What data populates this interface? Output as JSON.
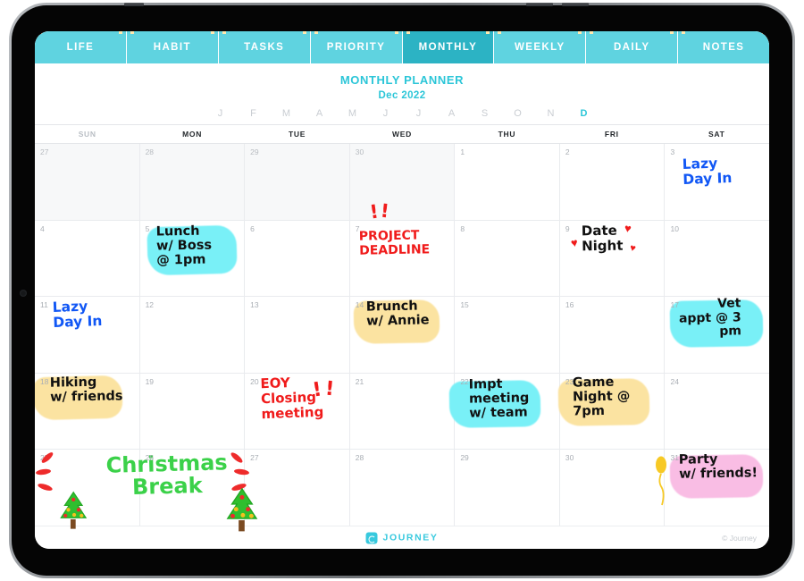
{
  "tabs": [
    {
      "label": "LIFE",
      "active": false
    },
    {
      "label": "HABIT",
      "active": false
    },
    {
      "label": "TASKS",
      "active": false
    },
    {
      "label": "PRIORITY",
      "active": false
    },
    {
      "label": "MONTHLY",
      "active": true
    },
    {
      "label": "WEEKLY",
      "active": false
    },
    {
      "label": "DAILY",
      "active": false
    },
    {
      "label": "NOTES",
      "active": false
    }
  ],
  "header": {
    "title": "MONTHLY PLANNER",
    "month_label": "Dec 2022",
    "accent_color": "#2cc6d8"
  },
  "month_strip": {
    "letters": [
      "J",
      "F",
      "M",
      "A",
      "M",
      "J",
      "J",
      "A",
      "S",
      "O",
      "N",
      "D"
    ],
    "active_index": 11
  },
  "weekdays": [
    {
      "label": "SUN",
      "dim": true
    },
    {
      "label": "MON",
      "dim": false
    },
    {
      "label": "TUE",
      "dim": false
    },
    {
      "label": "WED",
      "dim": false
    },
    {
      "label": "THU",
      "dim": false
    },
    {
      "label": "FRI",
      "dim": false
    },
    {
      "label": "SAT",
      "dim": false
    }
  ],
  "weeks": [
    [
      {
        "num": "27",
        "other_month": true
      },
      {
        "num": "28",
        "other_month": true
      },
      {
        "num": "29",
        "other_month": true
      },
      {
        "num": "30",
        "other_month": true
      },
      {
        "num": "1",
        "other_month": false
      },
      {
        "num": "2",
        "other_month": false
      },
      {
        "num": "3",
        "other_month": false
      }
    ],
    [
      {
        "num": "4",
        "other_month": false
      },
      {
        "num": "5",
        "other_month": false
      },
      {
        "num": "6",
        "other_month": false
      },
      {
        "num": "7",
        "other_month": false
      },
      {
        "num": "8",
        "other_month": false
      },
      {
        "num": "9",
        "other_month": false
      },
      {
        "num": "10",
        "other_month": false
      }
    ],
    [
      {
        "num": "11",
        "other_month": false
      },
      {
        "num": "12",
        "other_month": false
      },
      {
        "num": "13",
        "other_month": false
      },
      {
        "num": "14",
        "other_month": false
      },
      {
        "num": "15",
        "other_month": false
      },
      {
        "num": "16",
        "other_month": false
      },
      {
        "num": "17",
        "other_month": false
      }
    ],
    [
      {
        "num": "18",
        "other_month": false
      },
      {
        "num": "19",
        "other_month": false
      },
      {
        "num": "20",
        "other_month": false
      },
      {
        "num": "21",
        "other_month": false
      },
      {
        "num": "22",
        "other_month": false
      },
      {
        "num": "23",
        "other_month": false
      },
      {
        "num": "24",
        "other_month": false
      }
    ],
    [
      {
        "num": "25",
        "other_month": false
      },
      {
        "num": "26",
        "other_month": false
      },
      {
        "num": "27",
        "other_month": false
      },
      {
        "num": "28",
        "other_month": false
      },
      {
        "num": "29",
        "other_month": false
      },
      {
        "num": "30",
        "other_month": false
      },
      {
        "num": "31",
        "other_month": false
      }
    ]
  ],
  "entries": {
    "dec3": {
      "text": "Lazy\nDay In",
      "ink": "blue"
    },
    "dec5": {
      "text": "Lunch\nw/ Boss\n@ 1pm",
      "ink": "black",
      "highlight": "cyan"
    },
    "dec7": {
      "text": "PROJECT\nDEADLINE",
      "ink": "red",
      "marks": "!!"
    },
    "dec9": {
      "text": "Date\nNight",
      "ink": "black",
      "marks": "hearts"
    },
    "dec11": {
      "text": "Lazy\nDay In",
      "ink": "blue"
    },
    "dec14": {
      "text": "Brunch\nw/ Annie",
      "ink": "black",
      "highlight": "yellow"
    },
    "dec17": {
      "text": "Vet\nappt @ 3\npm",
      "ink": "black",
      "highlight": "cyan"
    },
    "dec18": {
      "text": "Hiking\nw/ friends",
      "ink": "black",
      "highlight": "yellow"
    },
    "dec20": {
      "text": "EOY\nClosing\nmeeting",
      "ink": "red",
      "marks": "!!"
    },
    "dec22": {
      "text": "Impt\nmeeting\nw/ team",
      "ink": "black",
      "highlight": "cyan"
    },
    "dec23": {
      "text": "Game\nNight @\n7pm",
      "ink": "black",
      "highlight": "yellow"
    },
    "dec25": {
      "text": "Christmas\nBreak",
      "ink": "green",
      "marks": "dashes-and-trees"
    },
    "dec31": {
      "text": "Party\nw/ friends!",
      "ink": "black",
      "highlight": "pink",
      "marks": "balloon"
    }
  },
  "footer": {
    "brand": "JOURNEY",
    "copyright": "© Journey"
  }
}
